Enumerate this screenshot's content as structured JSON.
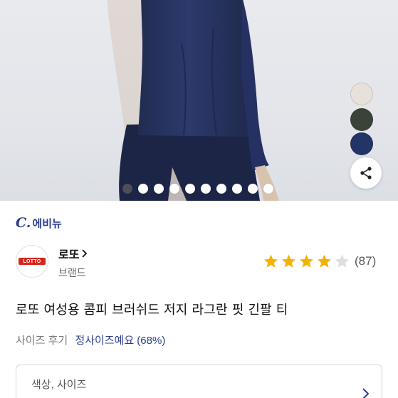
{
  "gallery": {
    "slide_count": 10,
    "active_slide": 0,
    "color_swatches": [
      {
        "name": "beige-swatch",
        "color": "#e6e1db"
      },
      {
        "name": "khaki-swatch",
        "color": "#3b4236"
      },
      {
        "name": "navy-swatch",
        "color": "#233566"
      }
    ],
    "share_icon": "share-icon"
  },
  "header": {
    "brand_c": "C.",
    "brand_text": "에비뉴"
  },
  "seller": {
    "logo_text": "LOTTO",
    "name": "로또",
    "category": "브랜드"
  },
  "rating": {
    "stars": 4,
    "max_stars": 5,
    "review_count": "(87)"
  },
  "product": {
    "title": "로또 여성용 콤피 브러쉬드 저지 라그란 핏 긴팔 티"
  },
  "size_review": {
    "label": "사이즈 후기",
    "value": "정사이즈예요 (68%)"
  },
  "option_select": {
    "placeholder": "색상, 사이즈"
  },
  "colors": {
    "accent": "#2a3d8f",
    "star": "#f5b301",
    "star_empty": "#dddddd",
    "garment": "#27335e"
  }
}
